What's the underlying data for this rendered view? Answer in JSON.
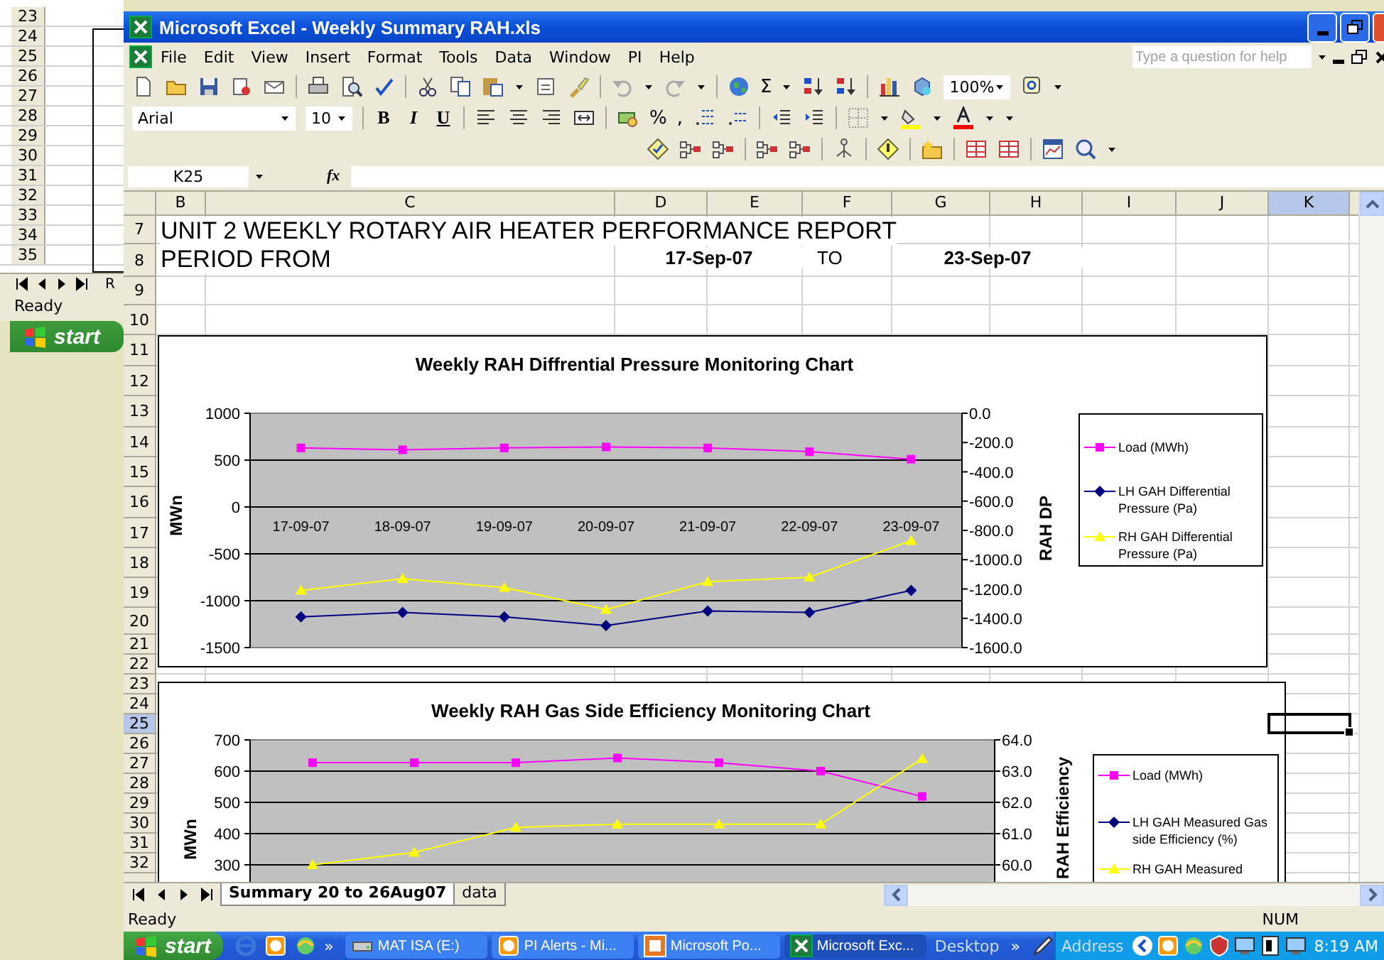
{
  "background_window": {
    "row_numbers": [
      "23",
      "24",
      "25",
      "26",
      "27",
      "28",
      "29",
      "30",
      "31",
      "32",
      "33",
      "34",
      "35"
    ],
    "tab_fragment": "R",
    "status": "Ready",
    "start_button": "start"
  },
  "window": {
    "title": "Microsoft Excel - Weekly Summary RAH.xls"
  },
  "menu_bar": {
    "items": [
      "File",
      "Edit",
      "View",
      "Insert",
      "Format",
      "Tools",
      "Data",
      "Window",
      "PI",
      "Help"
    ],
    "help_box": {
      "placeholder": "Type a question for help"
    }
  },
  "toolbar": {
    "autosum": "Σ",
    "zoom": "100%",
    "font": "Arial",
    "size": "10",
    "bold": "B",
    "italic": "I",
    "underline": "U",
    "percent": "%",
    "comma": ","
  },
  "formula_bar": {
    "name_box": "K25",
    "fx_label": "fx"
  },
  "sheet": {
    "columns": [
      {
        "label": "B",
        "selected": false
      },
      {
        "label": "C",
        "selected": false
      },
      {
        "label": "D",
        "selected": false
      },
      {
        "label": "E",
        "selected": false
      },
      {
        "label": "F",
        "selected": false
      },
      {
        "label": "G",
        "selected": false
      },
      {
        "label": "H",
        "selected": false
      },
      {
        "label": "I",
        "selected": false
      },
      {
        "label": "J",
        "selected": false
      },
      {
        "label": "K",
        "selected": true
      }
    ],
    "rows": [
      {
        "label": "7",
        "selected": false
      },
      {
        "label": "8",
        "selected": false
      },
      {
        "label": "9",
        "selected": false
      },
      {
        "label": "10",
        "selected": false
      },
      {
        "label": "11",
        "selected": false
      },
      {
        "label": "12",
        "selected": false
      },
      {
        "label": "13",
        "selected": false
      },
      {
        "label": "14",
        "selected": false
      },
      {
        "label": "15",
        "selected": false
      },
      {
        "label": "16",
        "selected": false
      },
      {
        "label": "17",
        "selected": false
      },
      {
        "label": "18",
        "selected": false
      },
      {
        "label": "19",
        "selected": false
      },
      {
        "label": "20",
        "selected": false
      },
      {
        "label": "21",
        "selected": false
      },
      {
        "label": "22",
        "selected": false
      },
      {
        "label": "23",
        "selected": false
      },
      {
        "label": "24",
        "selected": false
      },
      {
        "label": "25",
        "selected": true
      },
      {
        "label": "26",
        "selected": false
      },
      {
        "label": "27",
        "selected": false
      },
      {
        "label": "28",
        "selected": false
      },
      {
        "label": "29",
        "selected": false
      },
      {
        "label": "30",
        "selected": false
      },
      {
        "label": "31",
        "selected": false
      },
      {
        "label": "32",
        "selected": false
      }
    ],
    "report": {
      "title": "UNIT 2 WEEKLY ROTARY AIR HEATER PERFORMANCE REPORT",
      "period_label": "PERIOD FROM",
      "from_date": "17-Sep-07",
      "to_label": "TO",
      "to_date": "23-Sep-07"
    },
    "charts": [
      {
        "chart_data": {
          "type": "line",
          "title": "Weekly RAH Diffrential Pressure Monitoring Chart",
          "ylabel": "MWn",
          "y2label": "RAH DP",
          "categories": [
            "17-09-07",
            "18-09-07",
            "19-09-07",
            "20-09-07",
            "21-09-07",
            "22-09-07",
            "23-09-07"
          ],
          "grid": true,
          "legend": true,
          "ylim": [
            -1500,
            1000
          ],
          "yticks": [
            1000,
            500,
            0,
            -500,
            -1000,
            -1500
          ],
          "y2lim": [
            -1600,
            0
          ],
          "y2ticks": [
            {
              "value": 0,
              "label": "0.0"
            },
            {
              "value": -200,
              "label": "-200.0"
            },
            {
              "value": -400,
              "label": "-400.0"
            },
            {
              "value": -600,
              "label": "-600.0"
            },
            {
              "value": -800,
              "label": "-800.0"
            },
            {
              "value": -1000,
              "label": "-1000.0"
            },
            {
              "value": -1200,
              "label": "-1200.0"
            },
            {
              "value": -1400,
              "label": "-1400.0"
            },
            {
              "value": -1600,
              "label": "-1600.0"
            }
          ],
          "series": [
            {
              "name": "Load (MWh)",
              "color": "#ff00ff",
              "marker": "square",
              "values": [
                630,
                610,
                630,
                640,
                630,
                590,
                510
              ]
            },
            {
              "name": "LH GAH Differential Pressure (Pa)",
              "color": "#000080",
              "marker": "diamond",
              "axis": "y2",
              "values": [
                -1390,
                -1360,
                -1390,
                -1450,
                -1350,
                -1360,
                -1210
              ]
            },
            {
              "name": "RH GAH Differential Pressure (Pa)",
              "color": "#ffff00",
              "marker": "triangle",
              "axis": "y2",
              "values": [
                -1210,
                -1130,
                -1190,
                -1340,
                -1150,
                -1120,
                -870
              ]
            }
          ]
        }
      },
      {
        "chart_data": {
          "type": "line",
          "title": "Weekly RAH Gas Side Efficiency Monitoring Chart",
          "ylabel": "MWn",
          "y2label": "RAH Efficiency",
          "grid": true,
          "legend": true,
          "ylim": [
            250,
            700
          ],
          "yticks": [
            700,
            600,
            500,
            400,
            300
          ],
          "y2lim": [
            59.5,
            64
          ],
          "y2ticks": [
            {
              "value": 64,
              "label": "64.0"
            },
            {
              "value": 63,
              "label": "63.0"
            },
            {
              "value": 62,
              "label": "62.0"
            },
            {
              "value": 61,
              "label": "61.0"
            },
            {
              "value": 60,
              "label": "60.0"
            }
          ],
          "series": [
            {
              "name": "Load (MWh)",
              "color": "#ff00ff",
              "marker": "square",
              "values": [
                627,
                627,
                627,
                642,
                627,
                600,
                519
              ]
            },
            {
              "name": "LH GAH Measured Gas side Efficiency (%)",
              "color": "#000080",
              "marker": "diamond",
              "axis": "y2",
              "values": [
                null,
                null,
                null,
                null,
                null,
                null,
                null
              ]
            },
            {
              "name": "RH GAH Measured",
              "color": "#ffff00",
              "marker": "triangle",
              "axis": "y2",
              "values": [
                60.0,
                60.4,
                61.2,
                61.3,
                61.3,
                61.3,
                63.4
              ]
            }
          ]
        }
      }
    ]
  },
  "sheet_tabs": [
    {
      "label": "Summary 20 to 26Aug07",
      "selected": true
    },
    {
      "label": "data",
      "selected": false
    }
  ],
  "status_bar": {
    "status": "Ready",
    "num_lock": "NUM"
  },
  "taskbar": {
    "start": "start",
    "quick_launch_more": "»",
    "tasks": [
      {
        "label": "MAT ISA (E:)",
        "selected": false
      },
      {
        "label": "PI Alerts - Mi...",
        "selected": false
      },
      {
        "label": "Microsoft Po...",
        "selected": false
      },
      {
        "label": "Microsoft Exc...",
        "selected": true
      }
    ],
    "desktop": "Desktop",
    "toolbar_more": "»",
    "address": "Address",
    "clock": "8:19 AM"
  }
}
